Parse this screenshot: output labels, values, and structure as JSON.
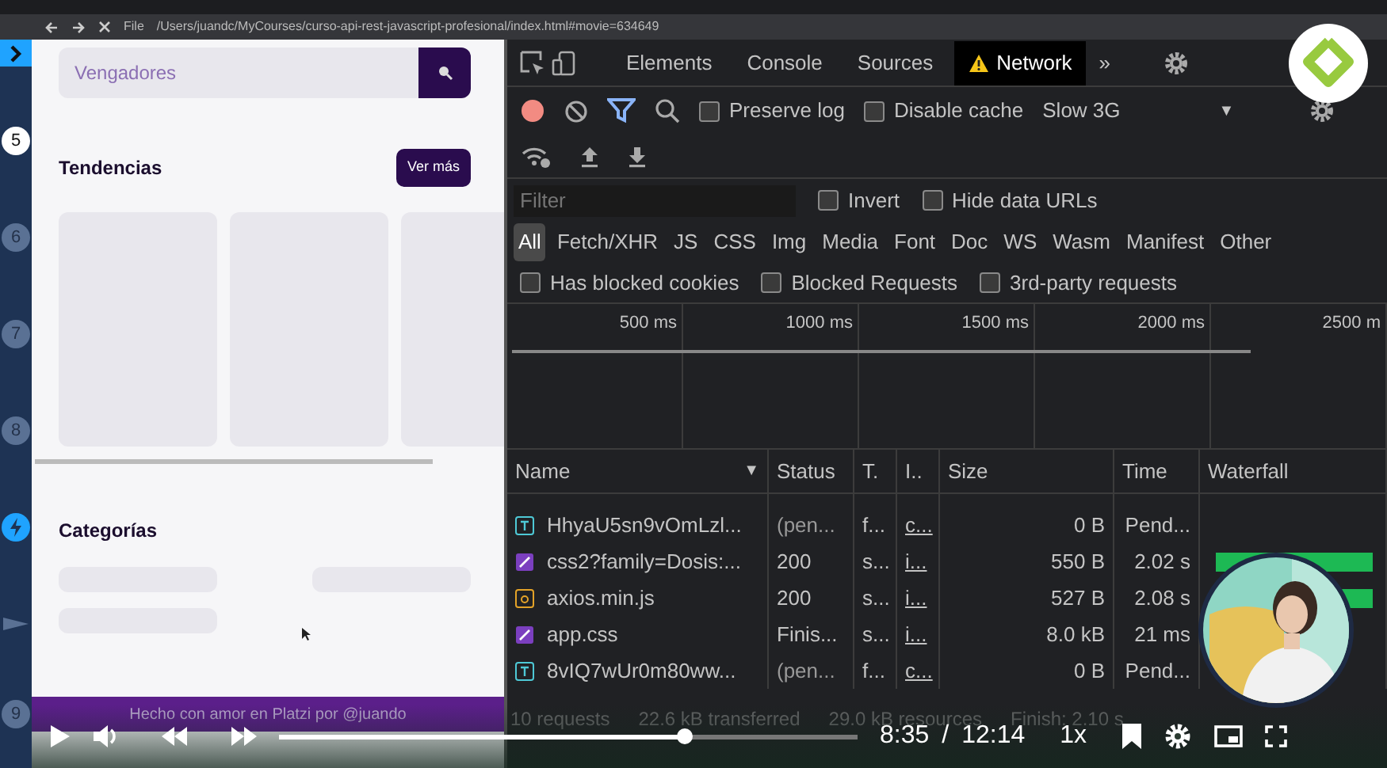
{
  "browser": {
    "file_label": "File",
    "url": "/Users/juandc/MyCourses/curso-api-rest-javascript-profesional/index.html#movie=634649"
  },
  "course_rail": {
    "steps": [
      {
        "kind": "number",
        "label": "5",
        "selected": true
      },
      {
        "kind": "number",
        "label": "6",
        "selected": false
      },
      {
        "kind": "number",
        "label": "7",
        "selected": false
      },
      {
        "kind": "number",
        "label": "8",
        "selected": false
      },
      {
        "kind": "lightning",
        "selected": false
      },
      {
        "kind": "flag",
        "selected": false
      },
      {
        "kind": "number",
        "label": "9",
        "selected": false
      }
    ]
  },
  "webpage": {
    "search": {
      "value": "Vengadores"
    },
    "trends": {
      "title": "Tendencias",
      "button": "Ver más"
    },
    "categories": {
      "title": "Categorías"
    },
    "footer": "Hecho con amor en Platzi por @juando"
  },
  "devtools": {
    "tabs": [
      {
        "label": "Elements",
        "selected": false,
        "warning": false
      },
      {
        "label": "Console",
        "selected": false,
        "warning": false
      },
      {
        "label": "Sources",
        "selected": false,
        "warning": false
      },
      {
        "label": "Network",
        "selected": true,
        "warning": true
      }
    ],
    "more": "»",
    "toolbar": {
      "recording": true,
      "filter_active": true,
      "preserve_log": false,
      "disable_cache": false,
      "preserve_label": "Preserve log",
      "cache_label": "Disable cache",
      "throttling": "Slow 3G",
      "caret": "▼"
    },
    "filter": {
      "placeholder": "Filter",
      "invert": false,
      "hide_data_urls": false,
      "invert_label": "Invert",
      "hide_label": "Hide data URLs"
    },
    "types": [
      {
        "label": "All",
        "selected": true
      },
      {
        "label": "Fetch/XHR",
        "selected": false
      },
      {
        "label": "JS",
        "selected": false
      },
      {
        "label": "CSS",
        "selected": false
      },
      {
        "label": "Img",
        "selected": false
      },
      {
        "label": "Media",
        "selected": false
      },
      {
        "label": "Font",
        "selected": false
      },
      {
        "label": "Doc",
        "selected": false
      },
      {
        "label": "WS",
        "selected": false
      },
      {
        "label": "Wasm",
        "selected": false
      },
      {
        "label": "Manifest",
        "selected": false
      },
      {
        "label": "Other",
        "selected": false
      }
    ],
    "blocked": [
      {
        "label": "Has blocked cookies",
        "checked": false
      },
      {
        "label": "Blocked Requests",
        "checked": false
      },
      {
        "label": "3rd-party requests",
        "checked": false
      }
    ],
    "overview_ticks": [
      "500 ms",
      "1000 ms",
      "1500 ms",
      "2000 ms",
      "2500 m"
    ],
    "columns": [
      "Name",
      "Status",
      "T.",
      "I..",
      "Size",
      "Time",
      "Waterfall"
    ],
    "sort_caret": "▼",
    "rows": [
      {
        "kind": "font",
        "name": "HhyaU5sn9vOmLzl...",
        "status": "(pen...",
        "type": "f...",
        "initiator": "c...",
        "size": "0 B",
        "time": "Pend...",
        "loaded": false
      },
      {
        "kind": "stylesheet",
        "name": "css2?family=Dosis:...",
        "status": "200",
        "type": "s...",
        "initiator": "i...",
        "size": "550 B",
        "time": "2.02 s",
        "loaded": true
      },
      {
        "kind": "script",
        "name": "axios.min.js",
        "status": "200",
        "type": "s...",
        "initiator": "i...",
        "size": "527 B",
        "time": "2.08 s",
        "loaded": true
      },
      {
        "kind": "stylesheet",
        "name": "app.css",
        "status": "Finis...",
        "type": "s...",
        "initiator": "i...",
        "size": "8.0 kB",
        "time": "21 ms",
        "loaded": false
      },
      {
        "kind": "font",
        "name": "8vIQ7wUr0m80ww...",
        "status": "(pen...",
        "type": "f...",
        "initiator": "c...",
        "size": "0 B",
        "time": "Pend...",
        "loaded": false
      }
    ],
    "summary": [
      "10 requests",
      "22.6 kB transferred",
      "29.0 kB resources",
      "Finish: 2.10 s"
    ]
  },
  "player": {
    "playing": false,
    "level": 0.7,
    "time": "8:35",
    "separator": "/",
    "duration": "12:14",
    "speed": "1x"
  }
}
